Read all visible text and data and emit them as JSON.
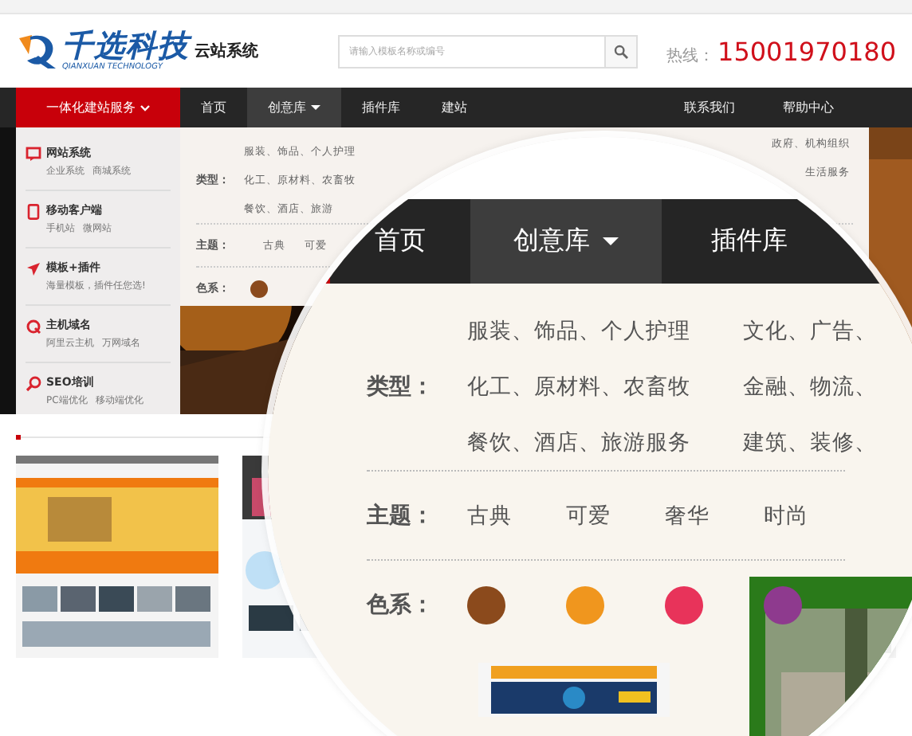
{
  "header": {
    "logo_text": "千选科技",
    "logo_subtext": "QIANXUAN TECHNOLOGY",
    "product": "云站系统",
    "search": {
      "placeholder": "请输入模板名称或编号"
    },
    "hotline_label": "热线：",
    "hotline": "15001970180"
  },
  "nav": {
    "service_menu": "一体化建站服务",
    "items": [
      {
        "label": "首页",
        "selected": false,
        "dropdown": false
      },
      {
        "label": "创意库",
        "selected": true,
        "dropdown": true
      },
      {
        "label": "插件库",
        "selected": false,
        "dropdown": false
      },
      {
        "label": "建站",
        "selected": false,
        "dropdown": false
      }
    ],
    "right_items": [
      "联系我们",
      "帮助中心"
    ]
  },
  "services": [
    {
      "kind": "site",
      "title": "网站系统",
      "links": [
        "企业系统",
        "商城系统"
      ]
    },
    {
      "kind": "mobile",
      "title": "移动客户端",
      "links": [
        "手机站",
        "微网站"
      ]
    },
    {
      "kind": "rocket",
      "title": "模板+插件",
      "links": [
        "海量模板，插件任您选!"
      ]
    },
    {
      "kind": "host",
      "title": "主机域名",
      "links": [
        "阿里云主机",
        "万网域名"
      ]
    },
    {
      "kind": "seo",
      "title": "SEO培训",
      "links": [
        "PC端优化",
        "移动端优化"
      ]
    }
  ],
  "category_panel": {
    "type_label": "类型：",
    "types": [
      "服装、饰品、个人护理",
      "化工、原材料、农畜牧",
      "餐饮、酒店、旅游"
    ],
    "types_right": [
      "政府、机构组织",
      "生活服务"
    ],
    "theme_label": "主题：",
    "themes": [
      "古典",
      "可爱"
    ],
    "color_label": "色系：",
    "colors": [
      {
        "color": "#8b4a1c"
      }
    ]
  },
  "magnifier": {
    "nav": [
      {
        "label": "首页",
        "selected": false,
        "dropdown": false
      },
      {
        "label": "创意库",
        "selected": true,
        "dropdown": true
      },
      {
        "label": "插件库",
        "selected": false,
        "dropdown": false
      }
    ],
    "type_label": "类型：",
    "types": [
      [
        "服装、饰品、个人护理",
        "文化、广告、"
      ],
      [
        "化工、原材料、农畜牧",
        "金融、物流、"
      ],
      [
        "餐饮、酒店、旅游服务",
        "建筑、装修、"
      ]
    ],
    "theme_label": "主题：",
    "themes": [
      "古典",
      "可爱",
      "奢华",
      "时尚"
    ],
    "color_label": "色系：",
    "colors": [
      {
        "color": "#8b4a1c"
      },
      {
        "color": "#f0961e"
      },
      {
        "color": "#e8335a"
      },
      {
        "color": "#8e3a8e"
      }
    ]
  }
}
